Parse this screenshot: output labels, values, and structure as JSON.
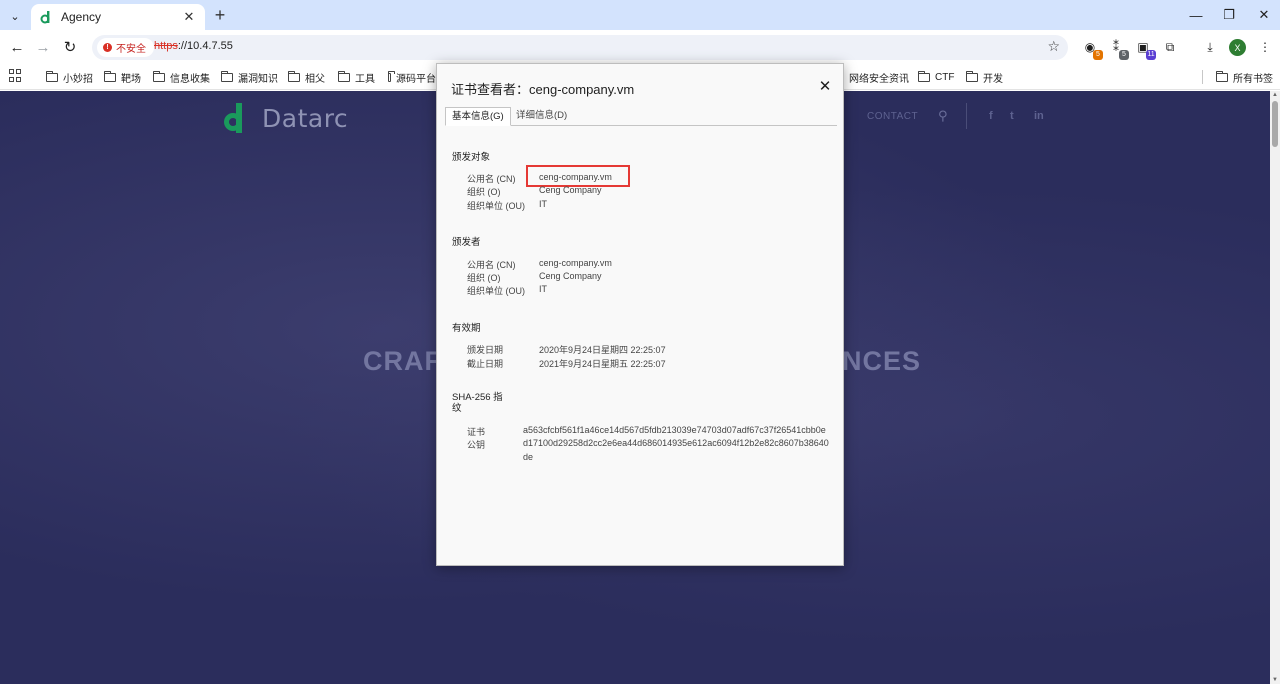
{
  "browser": {
    "tab_title": "Agency",
    "url_scheme": "https",
    "url_rest": "://10.4.7.55",
    "not_secure_label": "不安全",
    "extensions": [
      {
        "icon": "extension-a-icon",
        "badge": "5",
        "badge_color": "#e37400"
      },
      {
        "icon": "extension-b-icon",
        "badge": "5",
        "badge_color": "#5f6368"
      },
      {
        "icon": "extension-c-icon",
        "badge": "11",
        "badge_color": "#5b3fd3"
      }
    ],
    "profile_initial": "X"
  },
  "bookmarks": {
    "items": [
      "小妙招",
      "靶场",
      "信息收集",
      "漏洞知识",
      "相父",
      "工具",
      "源码平台",
      "网络安全资讯",
      "CTF",
      "开发"
    ],
    "all_bookmarks": "所有书签"
  },
  "site": {
    "brand": "Datarc",
    "nav_contact": "CONTACT",
    "social": [
      "f",
      "t",
      "in"
    ],
    "hero_left": "CRAF",
    "hero_right": "NCES",
    "colors": {
      "background": "#2b2d5c",
      "brand_green": "#1a9a5c"
    }
  },
  "dialog": {
    "title": "证书查看者：ceng-company.vm",
    "tabs": {
      "general": "基本信息(G)",
      "details": "详细信息(D)"
    },
    "issued_to": {
      "heading": "颁发对象",
      "cn_label": "公用名 (CN)",
      "cn": "ceng-company.vm",
      "o_label": "组织 (O)",
      "o": "Ceng Company",
      "ou_label": "组织单位 (OU)",
      "ou": "IT"
    },
    "issued_by": {
      "heading": "颁发者",
      "cn_label": "公用名 (CN)",
      "cn": "ceng-company.vm",
      "o_label": "组织 (O)",
      "o": "Ceng Company",
      "ou_label": "组织单位 (OU)",
      "ou": "IT"
    },
    "validity": {
      "heading": "有效期",
      "issued_label": "颁发日期",
      "issued": "2020年9月24日星期四 22:25:07",
      "expires_label": "截止日期",
      "expires": "2021年9月24日星期五 22:25:07"
    },
    "fingerprints": {
      "heading": "SHA-256 指纹",
      "cert_label": "证书",
      "cert": "a563cfcbf561f1a46ce14d567d5fdb213039e74703d07adf67c37f26541cbb0e",
      "key_label": "公钥",
      "key": "d17100d29258d2cc2e6ea44d686014935e612ac6094f12b2e82c8607b38640de"
    },
    "highlight_color": "#e53935"
  }
}
